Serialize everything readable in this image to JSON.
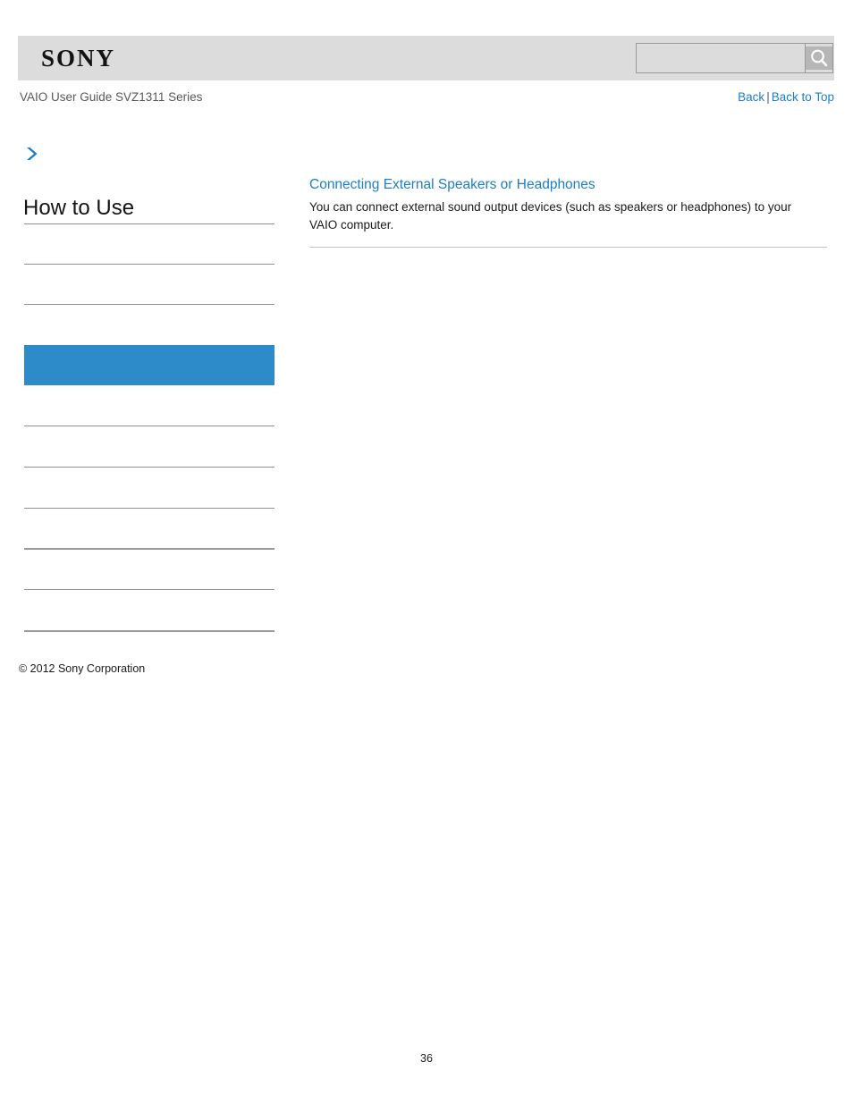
{
  "header": {
    "logo_text": "SONY",
    "search": {
      "value": "",
      "placeholder": "",
      "icon": "search-icon",
      "button_label": ""
    }
  },
  "breadcrumb": {
    "text": "VAIO User Guide SVZ1311 Series"
  },
  "top_links": {
    "back": "Back",
    "separator": "|",
    "back_to_top": "Back to Top"
  },
  "sidebar": {
    "arrow_icon": "chevron-right-icon",
    "title": "How to Use",
    "items": [
      {
        "label": "",
        "selected": false
      },
      {
        "label": "",
        "selected": false
      },
      {
        "label": "",
        "selected": false
      },
      {
        "label": "",
        "selected": true
      },
      {
        "label": "",
        "selected": false
      },
      {
        "label": "",
        "selected": false
      },
      {
        "label": "",
        "selected": false
      },
      {
        "label": "",
        "selected": false
      },
      {
        "label": "",
        "selected": false
      }
    ]
  },
  "main": {
    "heading": "Connecting External Speakers or Headphones",
    "body": "You can connect external sound output devices (such as speakers or headphones) to your VAIO computer."
  },
  "footer": {
    "copyright": "© 2012 Sony Corporation",
    "page_number": "36"
  },
  "colors": {
    "header_bg": "#dcdcdc",
    "link_blue": "#1a7ec8",
    "selected_blue": "#2e8bca",
    "rule_grey": "#8e8e8e",
    "text_dark": "#1a1a1a",
    "breadcrumb_grey": "#58585a"
  }
}
